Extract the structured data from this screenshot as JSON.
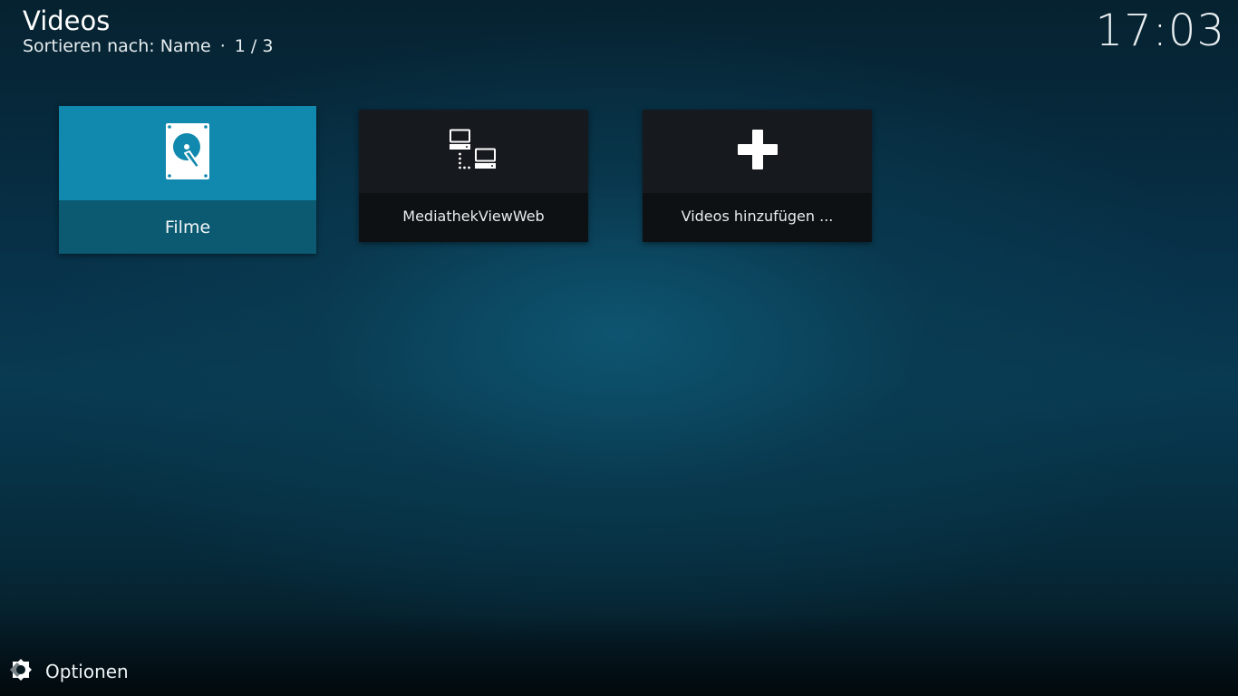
{
  "header": {
    "title": "Videos",
    "sort_label": "Sortieren nach: Name",
    "separator": "·",
    "page": "1 / 3"
  },
  "clock": "17:03",
  "tiles": [
    {
      "label": "Filme",
      "icon": "hard-drive-icon",
      "focused": true
    },
    {
      "label": "MediathekViewWeb",
      "icon": "network-icon",
      "focused": false
    },
    {
      "label": "Videos hinzufügen ...",
      "icon": "plus-icon",
      "focused": false
    }
  ],
  "footer": {
    "options_label": "Optionen",
    "icon": "options-gear-icon"
  },
  "colors": {
    "focus_top": "#1188ad",
    "focus_bottom": "#0b5a72",
    "tile_top": "#16191d",
    "tile_bottom": "#0e1114"
  }
}
